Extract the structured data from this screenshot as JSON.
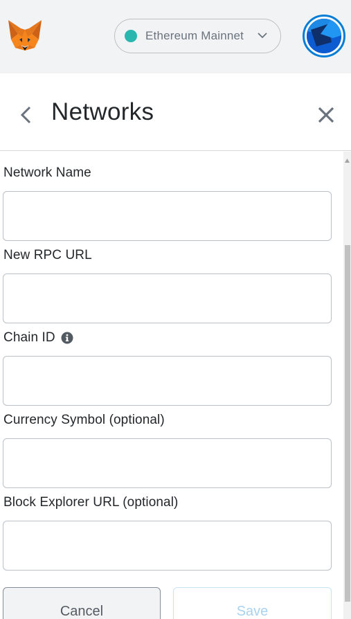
{
  "topbar": {
    "logo": "metamask-fox-logo",
    "network": {
      "label": "Ethereum Mainnet",
      "dot_color": "#29b6af",
      "icon": "chevron-down-icon"
    },
    "account_avatar": "account-identicon"
  },
  "header": {
    "back_icon": "chevron-left-icon",
    "title": "Networks",
    "close_icon": "close-icon"
  },
  "form": {
    "fields": [
      {
        "label": "Network Name",
        "value": "",
        "placeholder": ""
      },
      {
        "label": "New RPC URL",
        "value": "",
        "placeholder": ""
      },
      {
        "label": "Chain ID",
        "value": "",
        "placeholder": "",
        "info_icon": "info-icon"
      },
      {
        "label": "Currency Symbol (optional)",
        "value": "",
        "placeholder": ""
      },
      {
        "label": "Block Explorer URL (optional)",
        "value": "",
        "placeholder": ""
      }
    ],
    "cancel_label": "Cancel",
    "save_label": "Save"
  },
  "colors": {
    "accent": "#037dd6",
    "topbar_bg": "#f2f3f4",
    "save_disabled_text": "#a9d2ef",
    "network_dot": "#29b6af"
  }
}
